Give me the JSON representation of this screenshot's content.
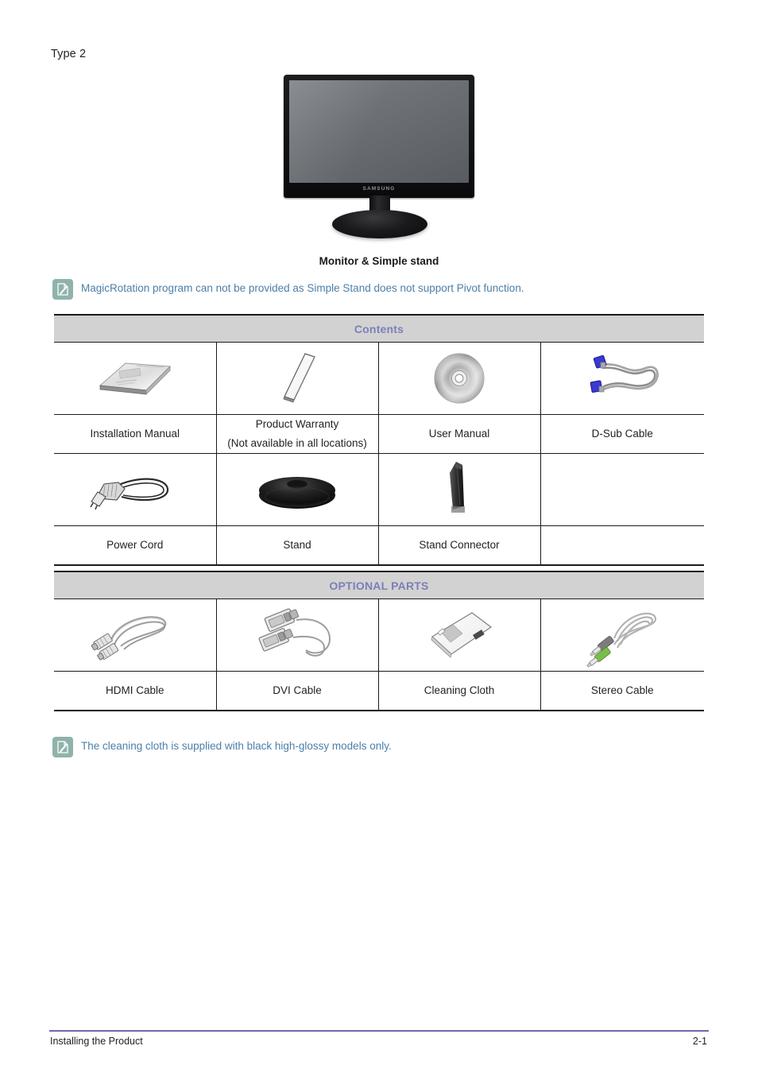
{
  "page": {
    "type_label": "Type 2",
    "hero_caption": "Monitor & Simple stand",
    "monitor_brand": "SAMSUNG"
  },
  "notes": {
    "top": {
      "icon": "note-pencil-icon",
      "text": "MagicRotation program can not be provided as Simple Stand does not support Pivot function."
    },
    "bottom": {
      "icon": "note-pencil-icon",
      "text": "The cleaning cloth is supplied with black high-glossy models only."
    }
  },
  "contents_table": {
    "header": "Contents",
    "rows": [
      {
        "items": [
          {
            "icon": "installation-manual-icon",
            "label": "Installation Manual",
            "label2": ""
          },
          {
            "icon": "product-warranty-icon",
            "label": "Product Warranty",
            "label2": "(Not available in all locations)"
          },
          {
            "icon": "cd-disc-icon",
            "label": "User Manual",
            "label2": ""
          },
          {
            "icon": "d-sub-cable-icon",
            "label": "D-Sub Cable",
            "label2": ""
          }
        ]
      },
      {
        "items": [
          {
            "icon": "power-cord-icon",
            "label": "Power Cord",
            "label2": ""
          },
          {
            "icon": "stand-base-icon",
            "label": "Stand",
            "label2": ""
          },
          {
            "icon": "stand-connector-icon",
            "label": "Stand Connector",
            "label2": ""
          },
          {
            "icon": "",
            "label": "",
            "label2": ""
          }
        ]
      }
    ]
  },
  "optional_table": {
    "header": "OPTIONAL PARTS",
    "rows": [
      {
        "items": [
          {
            "icon": "hdmi-cable-icon",
            "label": "HDMI Cable",
            "label2": ""
          },
          {
            "icon": "dvi-cable-icon",
            "label": "DVI Cable",
            "label2": ""
          },
          {
            "icon": "cleaning-cloth-icon",
            "label": "Cleaning Cloth",
            "label2": ""
          },
          {
            "icon": "stereo-cable-icon",
            "label": "Stereo Cable",
            "label2": ""
          }
        ]
      }
    ]
  },
  "footer": {
    "left": "Installing the Product",
    "right": "2-1"
  },
  "colors": {
    "section_header_bg": "#d2d2d2",
    "section_header_text": "#7b7fb8",
    "note_text": "#4c7fa8",
    "note_icon_bg": "#8fb3ab",
    "footer_rule": "#6b6ba8",
    "body_text": "#231f20",
    "dsub_connector": "#3a3ad0",
    "stereo_connector_green": "#78bf4a"
  }
}
